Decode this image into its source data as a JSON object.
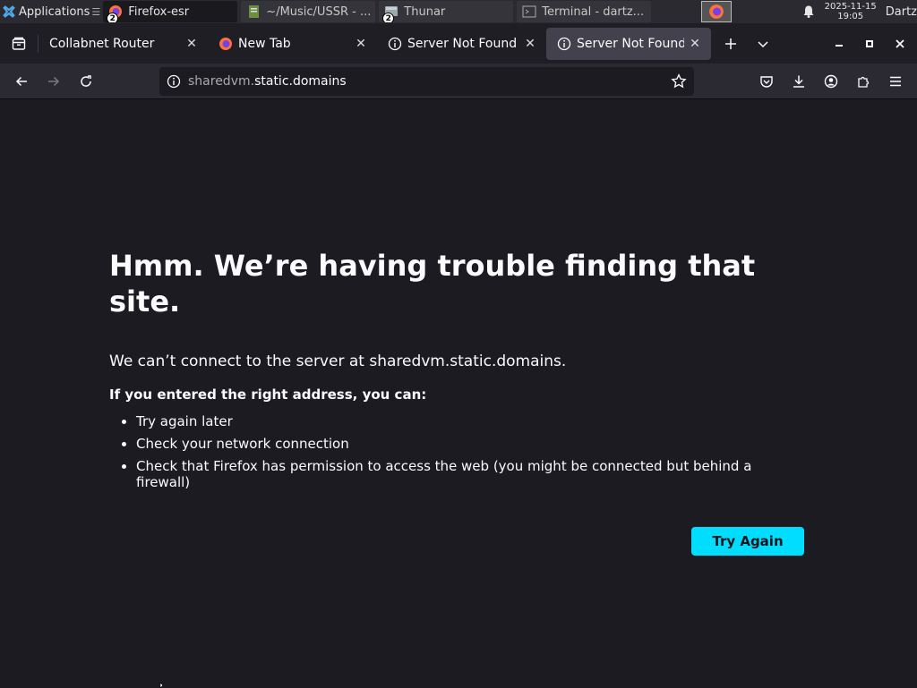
{
  "taskbar": {
    "apps_label": "Applications",
    "tasks": [
      {
        "label": "Firefox-esr",
        "badge": "2"
      },
      {
        "label": "~/Music/USSR - ..."
      },
      {
        "label": "Thunar",
        "badge": "2"
      },
      {
        "label": "Terminal - dartz..."
      }
    ],
    "clock_date": "2025-11-15",
    "clock_time": "19:05",
    "user": "Dartz"
  },
  "tabs": [
    {
      "label": "Collabnet Router",
      "selected": false
    },
    {
      "label": "New Tab",
      "selected": false
    },
    {
      "label": "Server Not Found",
      "selected": false
    },
    {
      "label": "Server Not Found",
      "selected": true
    }
  ],
  "urlbar": {
    "prefix": "sharedvm.",
    "domain": "static.domains"
  },
  "error": {
    "title": "Hmm. We’re having trouble finding that site.",
    "description": "We can’t connect to the server at sharedvm.static.domains.",
    "subheading": "If you entered the right address, you can:",
    "suggestions": [
      "Try again later",
      "Check your network connection",
      "Check that Firefox has permission to access the web (you might be connected but behind a firewall)"
    ],
    "button": "Try Again"
  },
  "colors": {
    "page_bg": "#1c1b22",
    "accent_button": "#00ddff",
    "selected_tab": "#42414d"
  }
}
